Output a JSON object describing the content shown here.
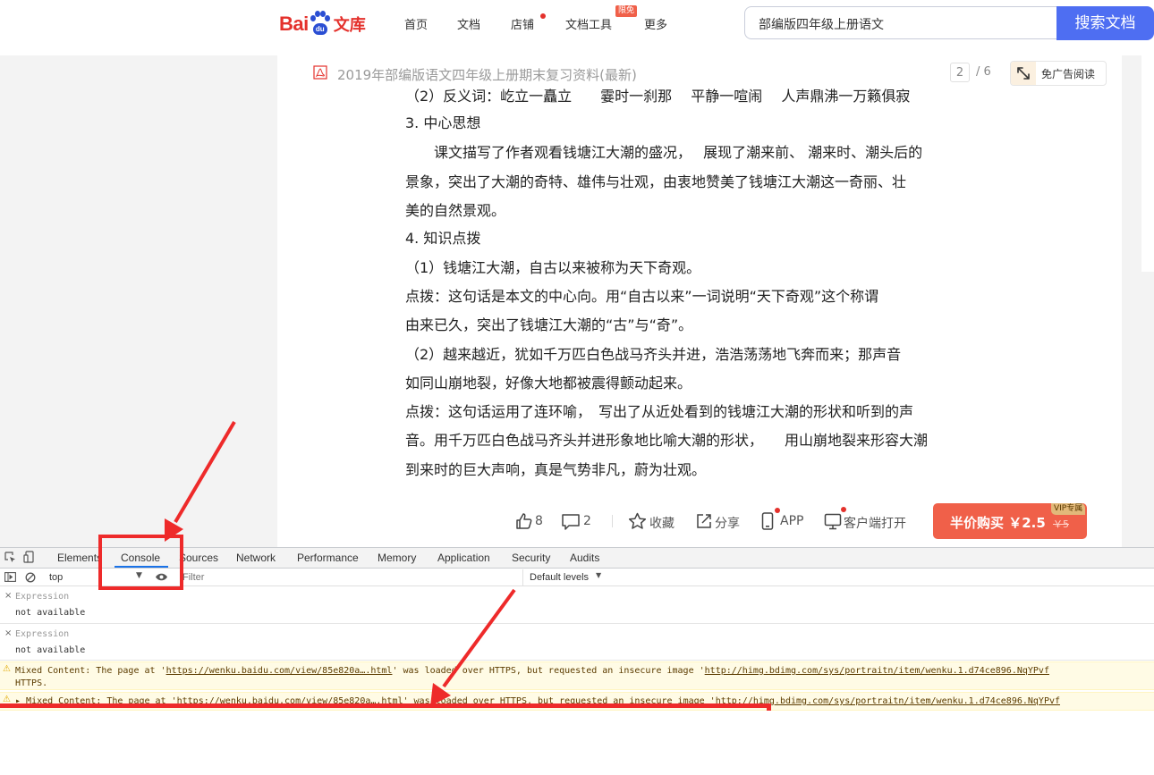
{
  "header": {
    "logo_text_bai": "Bai",
    "logo_text_du": "du",
    "logo_text_wenku": "文库",
    "nav": [
      {
        "label": "首页"
      },
      {
        "label": "文档"
      },
      {
        "label": "店铺"
      },
      {
        "label": "文档工具"
      },
      {
        "label": "更多"
      }
    ],
    "badge_limited": "限免",
    "search_value": "部编版四年级上册语文",
    "search_button": "搜索文档"
  },
  "document": {
    "title": "2019年部编版语文四年级上册期末复习资料(最新)",
    "page_current": "2",
    "page_total": "/ 6",
    "adfree_label": "免广告阅读",
    "lines": [
      "（2）反义词：屹立一矗立　　霎时一刹那　 平静一喧闹　 人声鼎沸一万籁俱寂",
      "3. 中心思想",
      "　　课文描写了作者观看钱塘江大潮的盛况，　 展现了潮来前、 潮来时、潮头后的",
      "景象，突出了大潮的奇特、雄伟与壮观，由衷地赞美了钱塘江大潮这一奇丽、壮",
      "美的自然景观。",
      "4. 知识点拨",
      "（1）钱塘江大潮，自古以来被称为天下奇观。",
      "点拨：这句话是本文的中心向。用“自古以来”一词说明“天下奇观”这个称谓",
      "由来已久，突出了钱塘江大潮的“古”与“奇”。",
      "（2）越来越近，犹如千万匹白色战马齐头并进，浩浩荡荡地飞奔而来；那声音",
      "如同山崩地裂，好像大地都被震得颤动起来。",
      "点拨：这句话运用了连环喻，　写出了从近处看到的钱塘江大潮的形状和听到的声",
      "音。用千万匹白色战马齐头并进形象地比喻大潮的形状，　　用山崩地裂来形容大潮",
      "到来时的巨大声响，真是气势非凡，蔚为壮观。"
    ]
  },
  "action_bar": {
    "likes": "8",
    "comments": "2",
    "collect": "收藏",
    "share": "分享",
    "app": "APP",
    "client_open": "客户端打开",
    "buy_label": "半价购买 ￥2.5",
    "buy_original": "￥5",
    "vip_tag": "VIP专属"
  },
  "devtools": {
    "tabs": [
      "Elements",
      "Console",
      "Sources",
      "Network",
      "Performance",
      "Memory",
      "Application",
      "Security",
      "Audits"
    ],
    "context": "top",
    "filter_placeholder": "Filter",
    "levels": "Default levels",
    "expressions": [
      {
        "label": "Expression",
        "value": "not available"
      },
      {
        "label": "Expression",
        "value": "not available"
      }
    ],
    "warnings": [
      {
        "pre": "Mixed Content: The page at '",
        "url1": "https://wenku.baidu.com/view/85e820a….html",
        "mid": "' was loaded over HTTPS, but requested an insecure image '",
        "url2": "http://himg.bdimg.com/sys/portraitn/item/wenku.1.d74ce896.NqYPvf",
        "cont": "HTTPS."
      },
      {
        "pre": "Mixed Content: The page at '",
        "url1": "https://wenku.baidu.com/view/85e820a….html",
        "mid": "' was loaded over HTTPS, but requested an insecure image '",
        "url2": "http://himg.bdimg.com/sys/portraitn/item/wenku.1.d74ce896.NqYPvf"
      }
    ]
  },
  "colors": {
    "accent_blue": "#4e6ef2",
    "baidu_red": "#e4312c",
    "buy_orange": "#f06049",
    "annotation_red": "#ee2a2a"
  }
}
